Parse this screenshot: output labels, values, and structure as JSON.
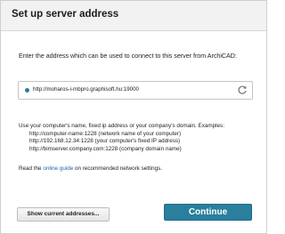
{
  "dialog": {
    "title": "Set up server address",
    "prompt": "Enter the address which can be used to connect to this server from ArchiCAD:",
    "address": "http://moharos-i-mbpro.graphisoft.hu:19000",
    "help_intro": "Use your computer's name, fixed ip address or your company's domain. Examples:",
    "examples": [
      "http://computer-name:1228 (network name of your computer)",
      "http://192.168.12.34:1228 (your computer's fixed IP address)",
      "http://bimserver.company.com:1228 (company domain name)"
    ],
    "read_prefix": "Read the ",
    "guide_link": "online guide",
    "read_suffix": " on recommended network settings.",
    "show_button": "Show current addresses...",
    "continue_button": "Continue"
  },
  "icons": {
    "status": "status-dot-icon",
    "refresh": "refresh-icon"
  },
  "colors": {
    "accent": "#2a7f9d",
    "link": "#1e63b6",
    "title_bar": "#f2f2f2"
  }
}
